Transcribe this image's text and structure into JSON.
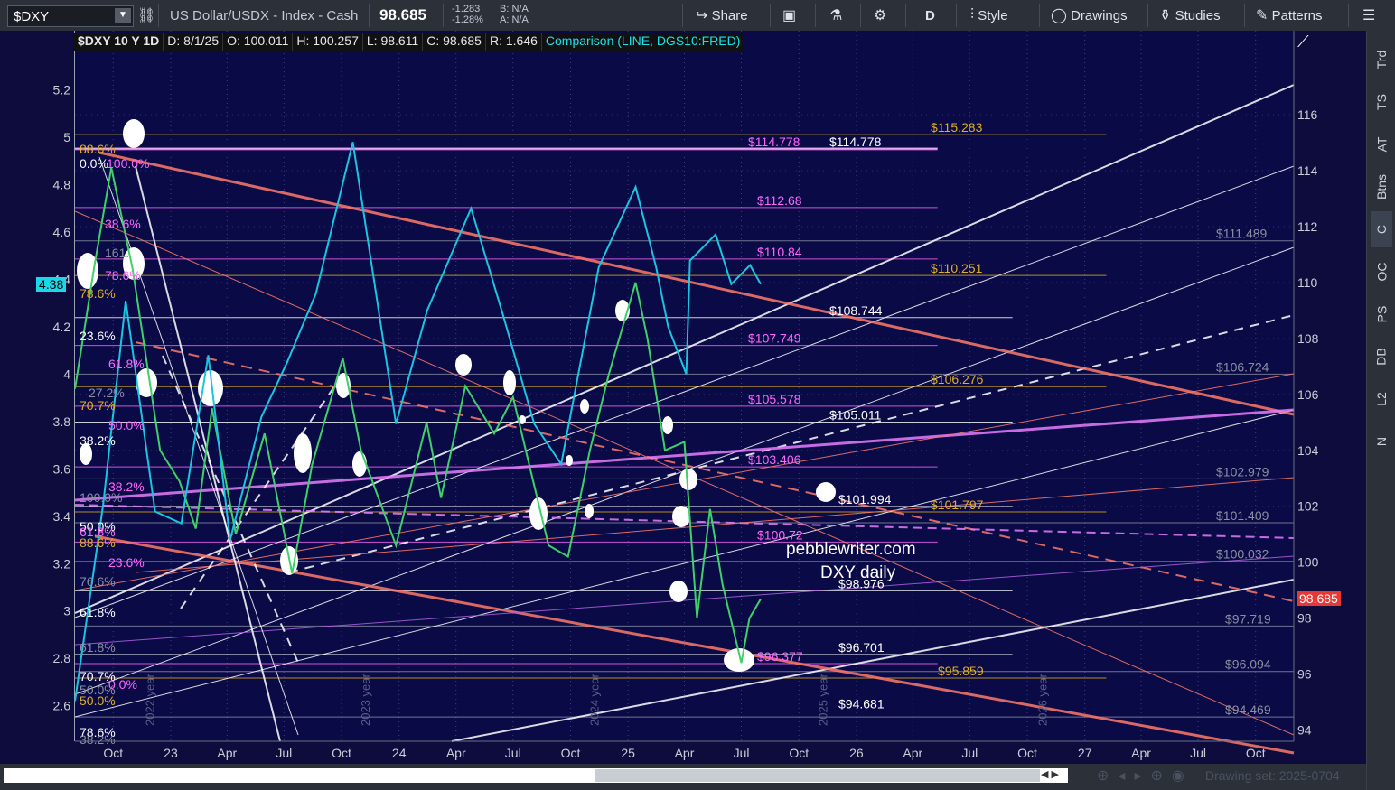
{
  "toolbar": {
    "symbol": "$DXY",
    "description": "US Dollar/USDX - Index - Cash",
    "last_price": "98.685",
    "change": "-1.283",
    "change_pct": "-1.28%",
    "bid": "B: N/A",
    "ask": "A: N/A",
    "share_label": "Share",
    "timeframe": "D",
    "style_label": "Style",
    "drawings_label": "Drawings",
    "studies_label": "Studies",
    "patterns_label": "Patterns"
  },
  "legend": {
    "title": "$DXY 10 Y 1D",
    "date": "D: 8/1/25",
    "open": "O: 100.011",
    "high": "H: 100.257",
    "low": "L: 98.611",
    "close": "C: 98.685",
    "range": "R: 1.646",
    "comparison": "Comparison (LINE, DGS10:FRED)"
  },
  "tags": {
    "left_current": "4.38",
    "right_current": "98.685"
  },
  "watermark": {
    "site": "pebblewriter.com",
    "caption": "DXY daily"
  },
  "year_markers": [
    "2022 year",
    "2023 year",
    "2024 year",
    "2025 year",
    "2026 year"
  ],
  "right_tabs": [
    "Trd",
    "TS",
    "AT",
    "Btns",
    "C",
    "OC",
    "PS",
    "DB",
    "L2",
    "N"
  ],
  "bottom": {
    "drawing_set": "Drawing set: 2025-0704"
  },
  "price_labels": [
    {
      "text": "$114.778",
      "color": "#ff66ff"
    },
    {
      "text": "$114.778",
      "color": "#ffffff"
    },
    {
      "text": "$115.283",
      "color": "#e0b020"
    },
    {
      "text": "$112.68",
      "color": "#ff66ff"
    },
    {
      "text": "$111.489",
      "color": "#8a8fa0"
    },
    {
      "text": "$110.84",
      "color": "#ff66ff"
    },
    {
      "text": "$110.251",
      "color": "#e0b020"
    },
    {
      "text": "$108.744",
      "color": "#ffffff"
    },
    {
      "text": "$107.749",
      "color": "#ff66ff"
    },
    {
      "text": "$106.724",
      "color": "#8a8fa0"
    },
    {
      "text": "$106.276",
      "color": "#e0b020"
    },
    {
      "text": "$105.578",
      "color": "#ff66ff"
    },
    {
      "text": "$105.011",
      "color": "#ffffff"
    },
    {
      "text": "$103.406",
      "color": "#ff66ff"
    },
    {
      "text": "$102.979",
      "color": "#8a8fa0"
    },
    {
      "text": "$101.994",
      "color": "#ffffff"
    },
    {
      "text": "$101.797",
      "color": "#e0b020"
    },
    {
      "text": "$101.409",
      "color": "#8a8fa0"
    },
    {
      "text": "$100.72",
      "color": "#ff66ff"
    },
    {
      "text": "$100.032",
      "color": "#8a8fa0"
    },
    {
      "text": "$98.976",
      "color": "#ffffff"
    },
    {
      "text": "$97.719",
      "color": "#8a8fa0"
    },
    {
      "text": "$96.701",
      "color": "#ffffff"
    },
    {
      "text": "$96.377",
      "color": "#ff66ff"
    },
    {
      "text": "$96.094",
      "color": "#8a8fa0"
    },
    {
      "text": "$95.859",
      "color": "#e0b020"
    },
    {
      "text": "$94.681",
      "color": "#ffffff"
    },
    {
      "text": "$94.469",
      "color": "#8a8fa0"
    }
  ],
  "fib_labels": [
    {
      "text": "88.6%",
      "color": "#e0b020"
    },
    {
      "text": "0.0%",
      "color": "#ffffff"
    },
    {
      "text": "100.0%",
      "color": "#ff66ff"
    },
    {
      "text": "38.6%",
      "color": "#ff66ff"
    },
    {
      "text": "161.",
      "color": "#8a8fa0"
    },
    {
      "text": "78.6%",
      "color": "#ff66ff"
    },
    {
      "text": "78.6%",
      "color": "#e0b020"
    },
    {
      "text": "23.6%",
      "color": "#ffffff"
    },
    {
      "text": "61.8%",
      "color": "#ff66ff"
    },
    {
      "text": "27.2%",
      "color": "#8a8fa0"
    },
    {
      "text": "70.7%",
      "color": "#e0b020"
    },
    {
      "text": "50.0%",
      "color": "#ff66ff"
    },
    {
      "text": "38.2%",
      "color": "#ffffff"
    },
    {
      "text": "38.2%",
      "color": "#ff66ff"
    },
    {
      "text": "100.0%",
      "color": "#8a8fa0"
    },
    {
      "text": "50.0%",
      "color": "#ffffff"
    },
    {
      "text": "61.8%",
      "color": "#ff66ff"
    },
    {
      "text": "88.6%",
      "color": "#e0b020"
    },
    {
      "text": "23.6%",
      "color": "#ff66ff"
    },
    {
      "text": "76.6%",
      "color": "#8a8fa0"
    },
    {
      "text": "61.8%",
      "color": "#ffffff"
    },
    {
      "text": "61.8%",
      "color": "#8a8fa0"
    },
    {
      "text": "70.7%",
      "color": "#ffffff"
    },
    {
      "text": "0.0%",
      "color": "#ff66ff"
    },
    {
      "text": "50.0%",
      "color": "#8a8fa0"
    },
    {
      "text": "50.0%",
      "color": "#e0b020"
    },
    {
      "text": "78.6%",
      "color": "#ffffff"
    },
    {
      "text": "38.2%",
      "color": "#8a8fa0"
    }
  ],
  "chart_data": {
    "type": "line",
    "title": "$DXY 10 Y 1D",
    "x_tick_labels": [
      "Oct",
      "23",
      "Apr",
      "Jul",
      "Oct",
      "24",
      "Apr",
      "Jul",
      "Oct",
      "25",
      "Apr",
      "Jul",
      "Oct",
      "26",
      "Apr",
      "Jul",
      "Oct",
      "27",
      "Apr",
      "Jul",
      "Oct"
    ],
    "right_axis_ticks": [
      94,
      96,
      98,
      100,
      102,
      104,
      106,
      108,
      110,
      112,
      114,
      116
    ],
    "left_axis_ticks": [
      2.6,
      2.8,
      3.0,
      3.2,
      3.4,
      3.6,
      3.8,
      4.0,
      4.2,
      4.4,
      4.6,
      4.8,
      5.0,
      5.2
    ],
    "left_axis_tick_labels": [
      "2.6",
      "2.8",
      "3",
      "3.2",
      "3.4",
      "3.6",
      "3.8",
      "4",
      "4.2",
      "4.4",
      "4.6",
      "4.8",
      "5",
      "5.2"
    ],
    "ylim_right": [
      93.6,
      119.0
    ],
    "ylim_left": [
      2.45,
      5.45
    ],
    "series": [
      {
        "name": "$DXY",
        "axis": "right",
        "color": "#3fd06a",
        "x": [
          "2022-08-01",
          "2022-09-01",
          "2022-09-28",
          "2022-11-01",
          "2022-12-15",
          "2023-01-15",
          "2023-02-10",
          "2023-03-08",
          "2023-04-15",
          "2023-05-31",
          "2023-07-14",
          "2023-08-15",
          "2023-10-03",
          "2023-11-01",
          "2023-12-27",
          "2024-02-14",
          "2024-03-08",
          "2024-04-16",
          "2024-06-01",
          "2024-07-01",
          "2024-08-27",
          "2024-09-27",
          "2024-11-01",
          "2024-12-01",
          "2025-01-13",
          "2025-02-01",
          "2025-03-01",
          "2025-04-01",
          "2025-04-21",
          "2025-05-12",
          "2025-06-01",
          "2025-07-01",
          "2025-07-14",
          "2025-08-01"
        ],
        "values": [
          106.2,
          110.6,
          114.1,
          110.5,
          104.0,
          102.9,
          101.2,
          105.5,
          101.0,
          104.6,
          99.6,
          103.5,
          107.3,
          104.0,
          100.6,
          105.0,
          102.3,
          106.3,
          104.6,
          105.9,
          100.6,
          100.2,
          104.0,
          106.7,
          110.0,
          108.0,
          104.0,
          104.3,
          98.0,
          101.9,
          99.2,
          96.4,
          98.0,
          98.685
        ]
      },
      {
        "name": "DGS10:FRED",
        "axis": "left",
        "color": "#19c5e0",
        "x": [
          "2022-08-01",
          "2022-09-15",
          "2022-10-21",
          "2022-12-07",
          "2023-01-18",
          "2023-03-02",
          "2023-04-06",
          "2023-05-26",
          "2023-07-06",
          "2023-08-21",
          "2023-10-19",
          "2023-12-27",
          "2024-02-15",
          "2024-04-25",
          "2024-06-15",
          "2024-08-04",
          "2024-09-16",
          "2024-11-15",
          "2025-01-13",
          "2025-02-15",
          "2025-03-06",
          "2025-04-04",
          "2025-04-10",
          "2025-05-21",
          "2025-06-15",
          "2025-07-15",
          "2025-08-01"
        ],
        "values": [
          2.62,
          3.45,
          4.31,
          3.42,
          3.37,
          4.08,
          3.3,
          3.82,
          4.05,
          4.34,
          4.98,
          3.79,
          4.27,
          4.7,
          4.25,
          3.79,
          3.62,
          4.45,
          4.79,
          4.45,
          4.2,
          4.0,
          4.48,
          4.59,
          4.38,
          4.46,
          4.38
        ]
      }
    ]
  }
}
